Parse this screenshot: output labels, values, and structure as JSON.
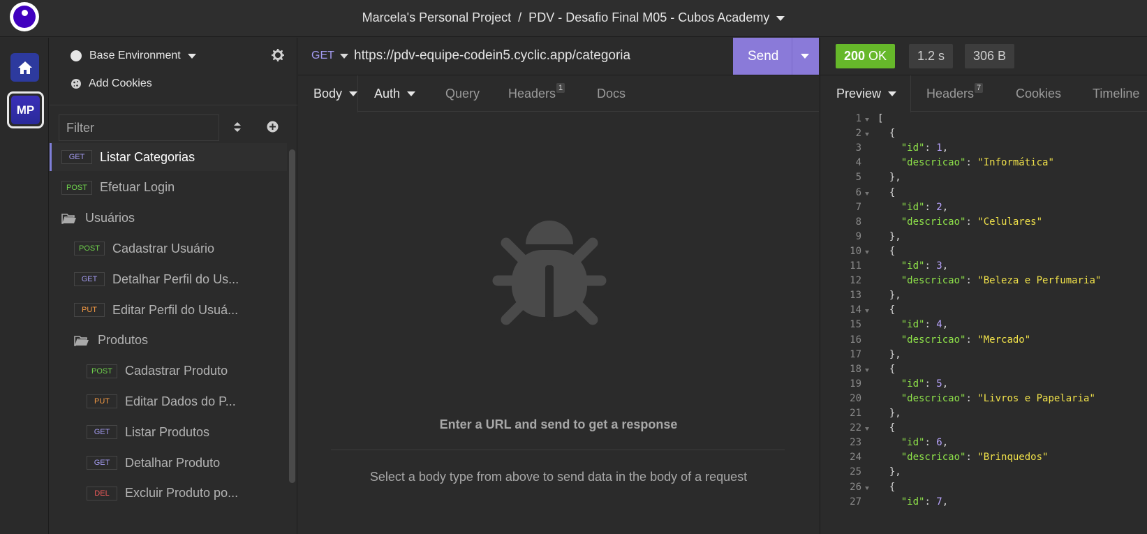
{
  "title_bar": {
    "project_title": "Marcela's Personal Project  /  PDV - Desafio Final M05 - Cubos Academy"
  },
  "rail": {
    "workspace_initials": "MP"
  },
  "sidebar": {
    "environment_label": "Base Environment",
    "cookies_label": "Add Cookies",
    "filter_placeholder": "Filter",
    "items": [
      {
        "kind": "request",
        "method": "GET",
        "label": "Listar Categorias",
        "active": true
      },
      {
        "kind": "request",
        "method": "POST",
        "label": "Efetuar Login"
      },
      {
        "kind": "folder",
        "label": "Usuários"
      },
      {
        "kind": "request",
        "method": "POST",
        "label": "Cadastrar Usuário"
      },
      {
        "kind": "request",
        "method": "GET",
        "label": "Detalhar Perfil do Us..."
      },
      {
        "kind": "request",
        "method": "PUT",
        "label": "Editar Perfil do Usuá..."
      },
      {
        "kind": "folder",
        "label": "Produtos"
      },
      {
        "kind": "request",
        "method": "POST",
        "label": "Cadastrar Produto"
      },
      {
        "kind": "request",
        "method": "PUT",
        "label": "Editar Dados do P..."
      },
      {
        "kind": "request",
        "method": "GET",
        "label": "Listar Produtos"
      },
      {
        "kind": "request",
        "method": "GET",
        "label": "Detalhar Produto"
      },
      {
        "kind": "request",
        "method": "DEL",
        "label": "Excluir Produto po..."
      }
    ]
  },
  "request": {
    "method": "GET",
    "url": "https://pdv-equipe-codein5.cyclic.app/categoria",
    "send_label": "Send",
    "tabs": {
      "body": "Body",
      "auth": "Auth",
      "query": "Query",
      "headers": "Headers",
      "headers_count": "1",
      "docs": "Docs"
    },
    "empty_title": "Enter a URL and send to get a response",
    "empty_hint": "Select a body type from above to send data in the body of a request"
  },
  "response": {
    "status_code": "200",
    "status_text": "OK",
    "time": "1.2 s",
    "size": "306 B",
    "tabs": {
      "preview": "Preview",
      "headers": "Headers",
      "headers_count": "7",
      "cookies": "Cookies",
      "timeline": "Timeline"
    },
    "json_lines": [
      {
        "n": "1",
        "fold": true,
        "parts": [
          [
            "p",
            "["
          ]
        ]
      },
      {
        "n": "2",
        "fold": true,
        "parts": [
          [
            "p",
            "  {"
          ]
        ]
      },
      {
        "n": "3",
        "parts": [
          [
            "p",
            "    "
          ],
          [
            "k",
            "\"id\""
          ],
          [
            "p",
            ": "
          ],
          [
            "n",
            "1"
          ],
          [
            "p",
            ","
          ]
        ]
      },
      {
        "n": "4",
        "parts": [
          [
            "p",
            "    "
          ],
          [
            "k",
            "\"descricao\""
          ],
          [
            "p",
            ": "
          ],
          [
            "s",
            "\"Informática\""
          ]
        ]
      },
      {
        "n": "5",
        "parts": [
          [
            "p",
            "  },"
          ]
        ]
      },
      {
        "n": "6",
        "fold": true,
        "parts": [
          [
            "p",
            "  {"
          ]
        ]
      },
      {
        "n": "7",
        "parts": [
          [
            "p",
            "    "
          ],
          [
            "k",
            "\"id\""
          ],
          [
            "p",
            ": "
          ],
          [
            "n",
            "2"
          ],
          [
            "p",
            ","
          ]
        ]
      },
      {
        "n": "8",
        "parts": [
          [
            "p",
            "    "
          ],
          [
            "k",
            "\"descricao\""
          ],
          [
            "p",
            ": "
          ],
          [
            "s",
            "\"Celulares\""
          ]
        ]
      },
      {
        "n": "9",
        "parts": [
          [
            "p",
            "  },"
          ]
        ]
      },
      {
        "n": "10",
        "fold": true,
        "parts": [
          [
            "p",
            "  {"
          ]
        ]
      },
      {
        "n": "11",
        "parts": [
          [
            "p",
            "    "
          ],
          [
            "k",
            "\"id\""
          ],
          [
            "p",
            ": "
          ],
          [
            "n",
            "3"
          ],
          [
            "p",
            ","
          ]
        ]
      },
      {
        "n": "12",
        "parts": [
          [
            "p",
            "    "
          ],
          [
            "k",
            "\"descricao\""
          ],
          [
            "p",
            ": "
          ],
          [
            "s",
            "\"Beleza e Perfumaria\""
          ]
        ]
      },
      {
        "n": "13",
        "parts": [
          [
            "p",
            "  },"
          ]
        ]
      },
      {
        "n": "14",
        "fold": true,
        "parts": [
          [
            "p",
            "  {"
          ]
        ]
      },
      {
        "n": "15",
        "parts": [
          [
            "p",
            "    "
          ],
          [
            "k",
            "\"id\""
          ],
          [
            "p",
            ": "
          ],
          [
            "n",
            "4"
          ],
          [
            "p",
            ","
          ]
        ]
      },
      {
        "n": "16",
        "parts": [
          [
            "p",
            "    "
          ],
          [
            "k",
            "\"descricao\""
          ],
          [
            "p",
            ": "
          ],
          [
            "s",
            "\"Mercado\""
          ]
        ]
      },
      {
        "n": "17",
        "parts": [
          [
            "p",
            "  },"
          ]
        ]
      },
      {
        "n": "18",
        "fold": true,
        "parts": [
          [
            "p",
            "  {"
          ]
        ]
      },
      {
        "n": "19",
        "parts": [
          [
            "p",
            "    "
          ],
          [
            "k",
            "\"id\""
          ],
          [
            "p",
            ": "
          ],
          [
            "n",
            "5"
          ],
          [
            "p",
            ","
          ]
        ]
      },
      {
        "n": "20",
        "parts": [
          [
            "p",
            "    "
          ],
          [
            "k",
            "\"descricao\""
          ],
          [
            "p",
            ": "
          ],
          [
            "s",
            "\"Livros e Papelaria\""
          ]
        ]
      },
      {
        "n": "21",
        "parts": [
          [
            "p",
            "  },"
          ]
        ]
      },
      {
        "n": "22",
        "fold": true,
        "parts": [
          [
            "p",
            "  {"
          ]
        ]
      },
      {
        "n": "23",
        "parts": [
          [
            "p",
            "    "
          ],
          [
            "k",
            "\"id\""
          ],
          [
            "p",
            ": "
          ],
          [
            "n",
            "6"
          ],
          [
            "p",
            ","
          ]
        ]
      },
      {
        "n": "24",
        "parts": [
          [
            "p",
            "    "
          ],
          [
            "k",
            "\"descricao\""
          ],
          [
            "p",
            ": "
          ],
          [
            "s",
            "\"Brinquedos\""
          ]
        ]
      },
      {
        "n": "25",
        "parts": [
          [
            "p",
            "  },"
          ]
        ]
      },
      {
        "n": "26",
        "fold": true,
        "parts": [
          [
            "p",
            "  {"
          ]
        ]
      },
      {
        "n": "27",
        "parts": [
          [
            "p",
            "    "
          ],
          [
            "k",
            "\"id\""
          ],
          [
            "p",
            ": "
          ],
          [
            "n",
            "7"
          ],
          [
            "p",
            ","
          ]
        ]
      }
    ]
  },
  "colors": {
    "accent": "#8a7ad9",
    "status_ok": "#66b82a",
    "method_get": "#a39bf0",
    "method_post": "#6fd24c",
    "method_put": "#f49a44",
    "method_del": "#ef5a5a"
  },
  "icons": [
    "app-logo-icon",
    "home-icon",
    "gear-icon",
    "cookie-icon",
    "sort-icon",
    "add-icon",
    "folder-icon",
    "bug-icon",
    "chevron-down-icon"
  ]
}
